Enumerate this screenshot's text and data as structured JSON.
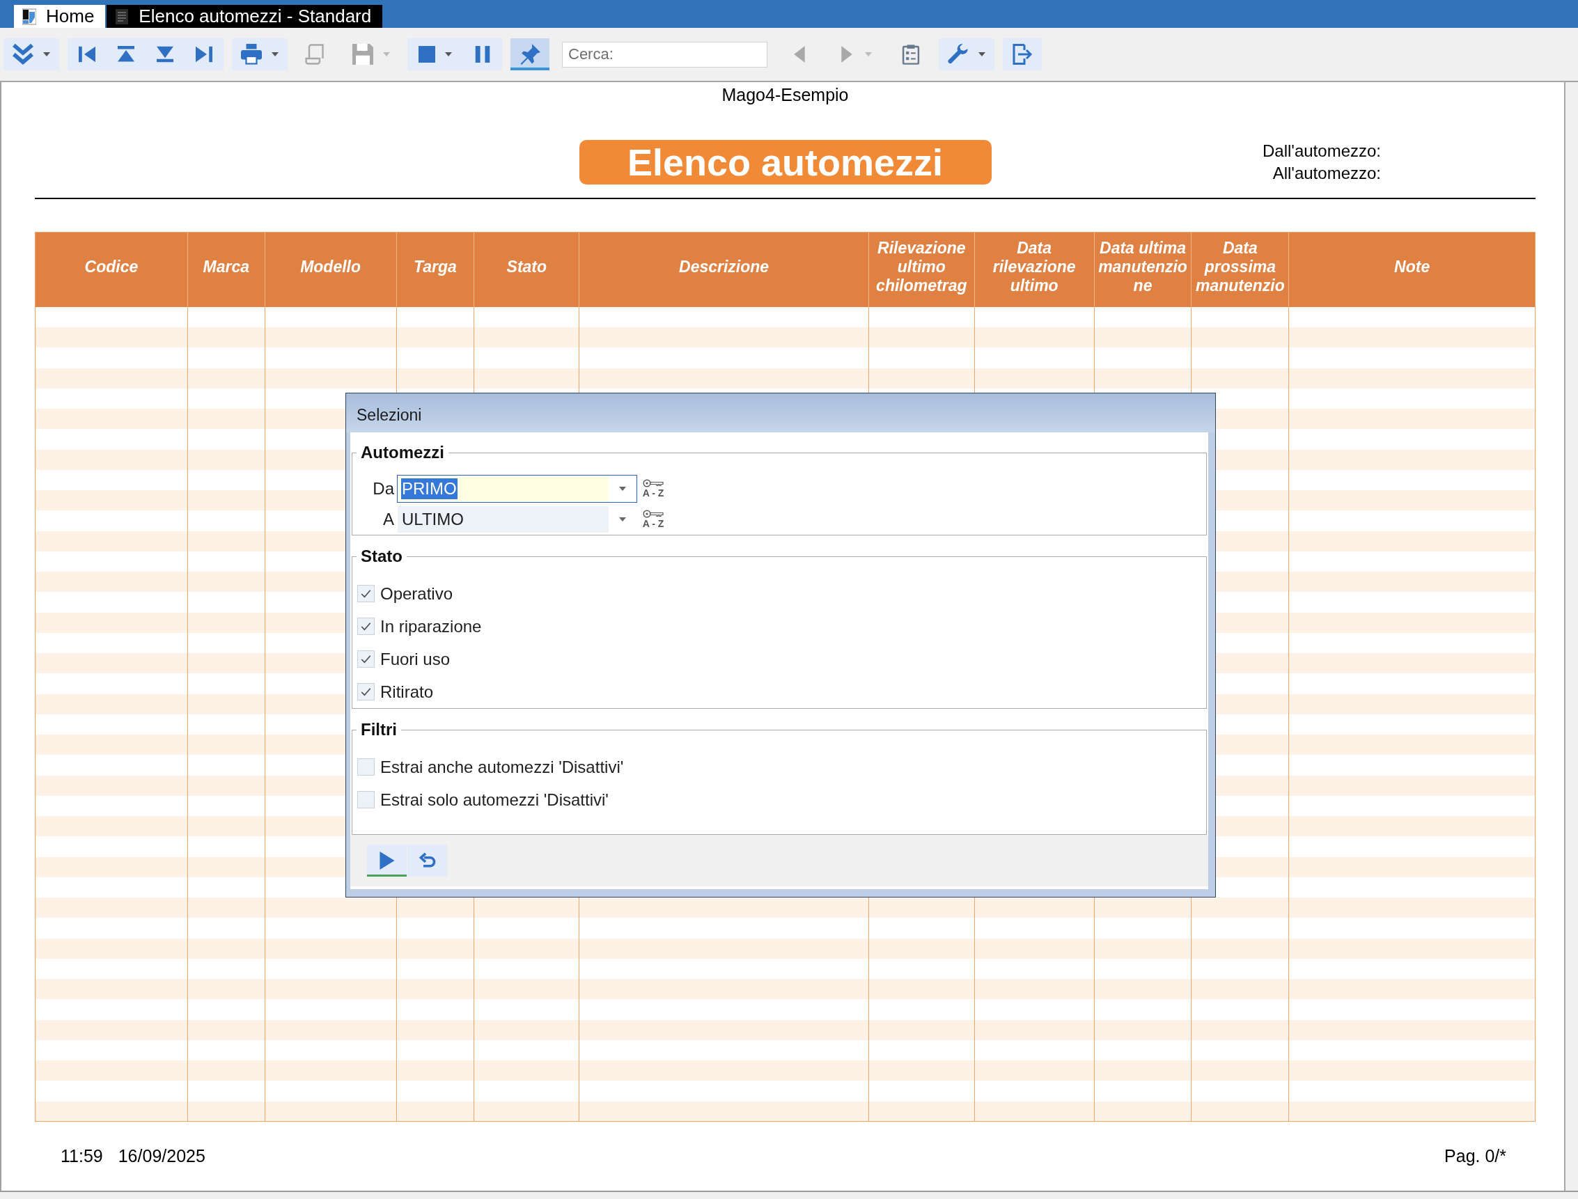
{
  "tabs": [
    {
      "kind": "home",
      "label": "Home",
      "selected": false
    },
    {
      "kind": "report",
      "label": "Elenco automezzi - Standard",
      "selected": true
    }
  ],
  "toolbar": [
    {
      "kind": "group",
      "buttons": [
        {
          "menu": true,
          "disabled": false,
          "pressed": false
        }
      ]
    },
    {
      "kind": "group",
      "buttons": [
        {
          "menu": false,
          "disabled": false,
          "pressed": false
        },
        {
          "menu": false,
          "disabled": false,
          "pressed": false
        },
        {
          "menu": false,
          "disabled": false,
          "pressed": false
        },
        {
          "menu": false,
          "disabled": false,
          "pressed": false
        }
      ]
    },
    {
      "kind": "group",
      "buttons": [
        {
          "menu": true,
          "disabled": false,
          "pressed": false
        }
      ]
    },
    {
      "kind": "button",
      "menu": false,
      "disabled": true,
      "pressed": false
    },
    {
      "kind": "button",
      "menu": true,
      "disabled": true,
      "pressed": false
    },
    {
      "kind": "group",
      "buttons": [
        {
          "menu": true,
          "disabled": false,
          "pressed": false
        },
        {
          "menu": false,
          "disabled": false,
          "pressed": false
        }
      ]
    },
    {
      "kind": "group",
      "buttons": [
        {
          "menu": false,
          "disabled": false,
          "pressed": true
        }
      ]
    },
    {
      "kind": "search",
      "placeholder": "Cerca:"
    },
    {
      "kind": "button",
      "menu": false,
      "disabled": true,
      "pressed": false
    },
    {
      "kind": "button",
      "menu": true,
      "disabled": true,
      "pressed": false
    },
    {
      "kind": "button",
      "menu": false,
      "disabled": false,
      "pressed": false
    },
    {
      "kind": "group",
      "buttons": [
        {
          "menu": true,
          "disabled": false,
          "pressed": false
        }
      ]
    },
    {
      "kind": "group",
      "buttons": [
        {
          "menu": false,
          "disabled": false,
          "pressed": false
        }
      ]
    }
  ],
  "report": {
    "company": "Mago4-Esempio",
    "title": "Elenco automezzi",
    "range_labels": [
      "Dall'automezzo:",
      "All'automezzo:"
    ],
    "table": {
      "columns": [
        "Codice",
        "Marca",
        "Modello",
        "Targa",
        "Stato",
        "Descrizione",
        "Rilevazione ultimo chilometrag",
        "Data rilevazione ultimo",
        "Data ultima manutenzione",
        "Data prossima manutenzio",
        "Note"
      ]
    },
    "footer": {
      "time": "11:59",
      "date": "16/09/2025",
      "page": "Pag. 0/*"
    }
  },
  "dialog": {
    "title": "Selezioni",
    "sections": [
      {
        "kind": "range",
        "title": "Automezzi",
        "fields": [
          {
            "label": "Da",
            "value": "PRIMO",
            "focused": true,
            "lookup": "A - Z"
          },
          {
            "label": "A",
            "value": "ULTIMO",
            "focused": false,
            "lookup": "A - Z"
          }
        ]
      },
      {
        "kind": "checks",
        "title": "Stato",
        "items": [
          {
            "label": "Operativo",
            "checked": true
          },
          {
            "label": "In riparazione",
            "checked": true
          },
          {
            "label": "Fuori uso",
            "checked": true
          },
          {
            "label": "Ritirato",
            "checked": true
          }
        ]
      },
      {
        "kind": "checks",
        "title": "Filtri",
        "items": [
          {
            "label": "Estrai anche automezzi 'Disattivi'",
            "checked": false
          },
          {
            "label": "Estrai solo automezzi 'Disattivi'",
            "checked": false
          }
        ]
      }
    ],
    "buttons": [
      {
        "kind": "run",
        "default": true
      },
      {
        "kind": "reset",
        "default": false
      }
    ]
  }
}
